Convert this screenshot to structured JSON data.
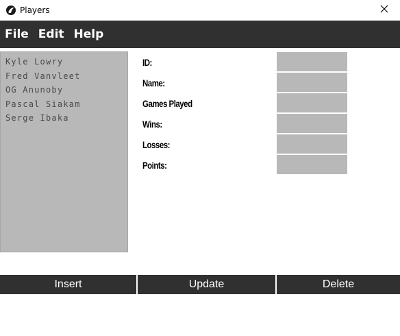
{
  "window": {
    "title": "Players",
    "app_icon": "raptor-claw-icon",
    "close_icon": "close-icon"
  },
  "menu": {
    "items": [
      "File",
      "Edit",
      "Help"
    ]
  },
  "players": [
    "Kyle Lowry",
    "Fred Vanvleet",
    "OG Anunoby",
    "Pascal Siakam",
    "Serge Ibaka"
  ],
  "form": {
    "fields": [
      {
        "label": "ID:",
        "value": ""
      },
      {
        "label": "Name:",
        "value": ""
      },
      {
        "label": "Games Played",
        "value": ""
      },
      {
        "label": "Wins:",
        "value": ""
      },
      {
        "label": "Losses:",
        "value": ""
      },
      {
        "label": "Points:",
        "value": ""
      }
    ]
  },
  "actions": {
    "insert": "Insert",
    "update": "Update",
    "delete": "Delete"
  },
  "colors": {
    "dark_bar": "#303030",
    "panel_gray": "#b8b8b8",
    "text_light": "#ffffff"
  }
}
